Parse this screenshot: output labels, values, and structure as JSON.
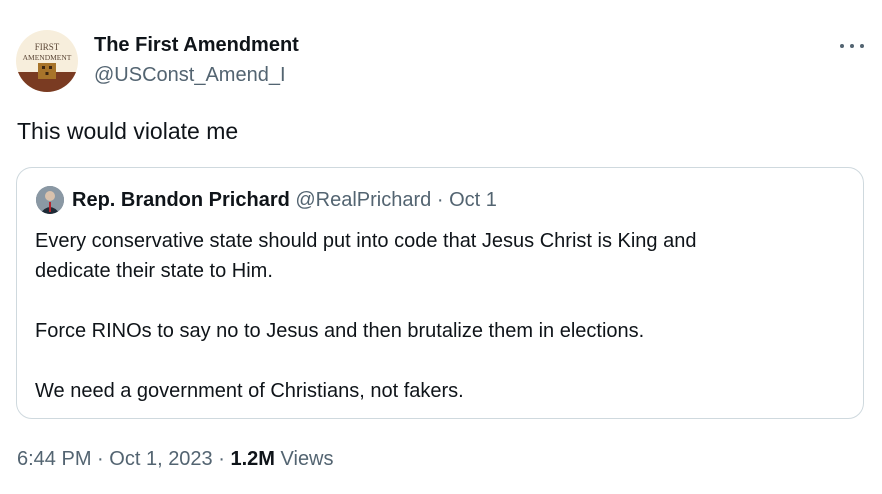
{
  "author": {
    "display_name": "The First Amendment",
    "handle": "@USConst_Amend_I",
    "avatar_text_top": "FIRST",
    "avatar_text_bottom": "AMENDMENT"
  },
  "tweet": {
    "text": "This would violate me"
  },
  "quoted": {
    "display_name": "Rep. Brandon Prichard",
    "handle": "@RealPrichard",
    "separator": "·",
    "date": "Oct 1",
    "lines": [
      "Every conservative state should put into code that Jesus Christ is King and",
      "dedicate their state to Him.",
      "",
      "Force RINOs to say no to Jesus and then brutalize them in elections.",
      "",
      "We need a government of Christians, not fakers."
    ]
  },
  "meta": {
    "time": "6:44 PM",
    "separator": "·",
    "date": "Oct 1, 2023",
    "views_count": "1.2M",
    "views_label": "Views"
  },
  "icons": {
    "more": "more-horizontal-icon"
  },
  "colors": {
    "text": "#0f1419",
    "secondary": "#536471",
    "border": "#cfd9de"
  }
}
